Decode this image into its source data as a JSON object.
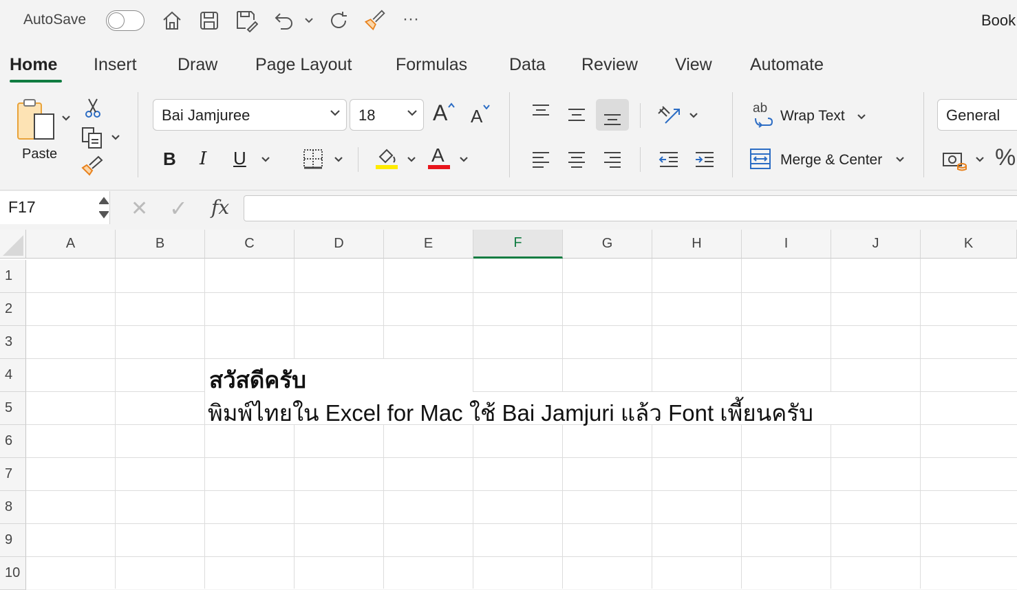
{
  "titlebar": {
    "autosave_label": "AutoSave",
    "autosave_on": false,
    "doc_title": "Book",
    "more_label": "···"
  },
  "tabs": [
    {
      "label": "Home",
      "active": true
    },
    {
      "label": "Insert"
    },
    {
      "label": "Draw"
    },
    {
      "label": "Page Layout"
    },
    {
      "label": "Formulas"
    },
    {
      "label": "Data"
    },
    {
      "label": "Review"
    },
    {
      "label": "View"
    },
    {
      "label": "Automate"
    }
  ],
  "ribbon": {
    "paste_label": "Paste",
    "font_name": "Bai Jamjuree",
    "font_size": "18",
    "bold": "B",
    "italic": "I",
    "underline": "U",
    "font_color_glyph": "A",
    "grow_glyph": "A",
    "shrink_glyph": "A",
    "wrap_text_label": "Wrap Text",
    "merge_center_label": "Merge & Center",
    "number_format": "General",
    "percent_glyph": "%",
    "wrap_glyph": "ab",
    "highlight_color": "#ffeb00",
    "font_color": "#e8141b"
  },
  "formula_bar": {
    "name_box": "F17",
    "cancel_glyph": "✕",
    "confirm_glyph": "✓",
    "fx": "fx",
    "value": ""
  },
  "grid": {
    "columns": [
      "A",
      "B",
      "C",
      "D",
      "E",
      "F",
      "G",
      "H",
      "I",
      "J",
      "K"
    ],
    "selected_column": "F",
    "rows": [
      "1",
      "2",
      "3",
      "4",
      "5",
      "6",
      "7",
      "8",
      "9",
      "10"
    ],
    "cells": {
      "C4": "สวัสดีครับ",
      "C5": "พิมพ์ไทยใน Excel for Mac ใช้ Bai Jamjuri แล้ว Font เพี้ยนครับ"
    }
  },
  "colors": {
    "accent": "#107c41",
    "background": "#f3f3f3"
  }
}
